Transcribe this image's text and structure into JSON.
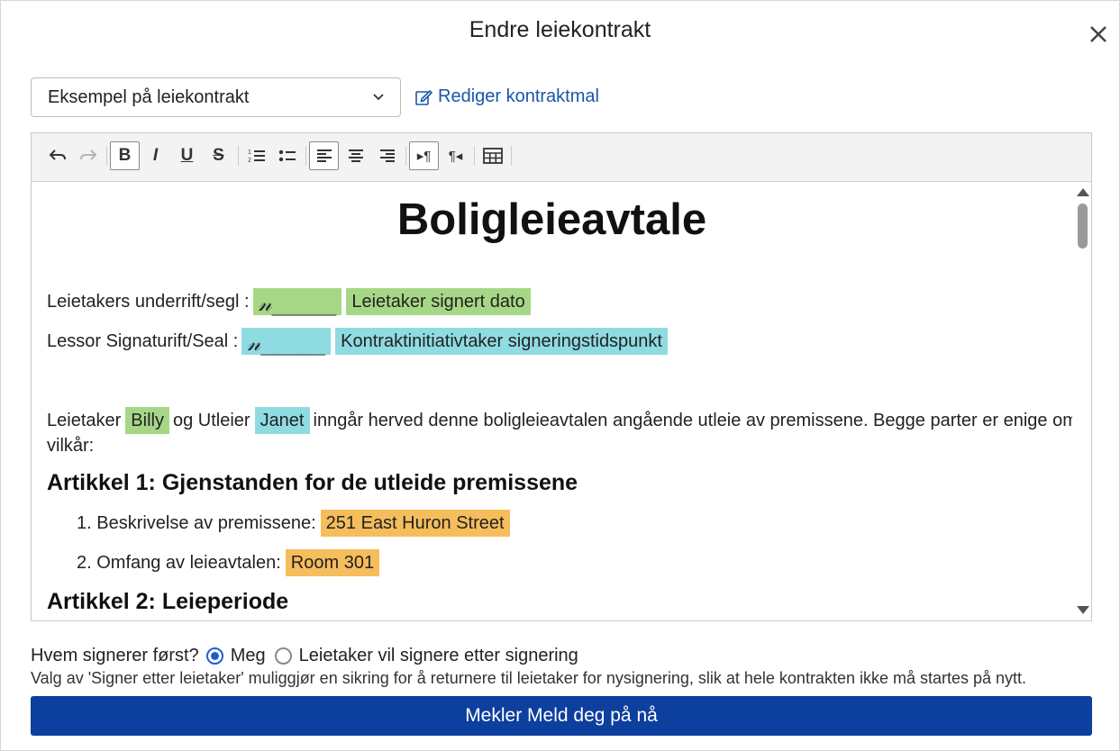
{
  "dialog": {
    "title": "Endre leiekontrakt",
    "close_icon": "close-icon"
  },
  "template_select": {
    "value": "Eksempel på leiekontrakt"
  },
  "edit_template_link": {
    "label": "Rediger kontraktmal",
    "icon": "edit-icon"
  },
  "toolbar": {
    "buttons": [
      {
        "name": "undo",
        "icon": "undo-icon",
        "glyph": "↶"
      },
      {
        "name": "redo",
        "icon": "redo-icon",
        "glyph": "↷",
        "disabled": true
      },
      {
        "name": "bold",
        "icon": "bold-icon",
        "glyph": "B",
        "active": true
      },
      {
        "name": "italic",
        "icon": "italic-icon",
        "glyph": "I"
      },
      {
        "name": "underline",
        "icon": "underline-icon",
        "glyph": "U"
      },
      {
        "name": "strikethrough",
        "icon": "strikethrough-icon",
        "glyph": "S"
      },
      {
        "name": "ordered-list",
        "icon": "ordered-list-icon",
        "glyph": "≡"
      },
      {
        "name": "bullet-list",
        "icon": "bullet-list-icon",
        "glyph": "•"
      },
      {
        "name": "align-left",
        "icon": "align-left-icon",
        "glyph": "≡",
        "active": true
      },
      {
        "name": "align-center",
        "icon": "align-center-icon",
        "glyph": "≡"
      },
      {
        "name": "align-right",
        "icon": "align-right-icon",
        "glyph": "≡"
      },
      {
        "name": "ltr",
        "icon": "ltr-icon",
        "glyph": "▸¶",
        "active": true
      },
      {
        "name": "rtl",
        "icon": "rtl-icon",
        "glyph": "¶◂"
      },
      {
        "name": "table",
        "icon": "table-icon",
        "glyph": "⊞"
      }
    ]
  },
  "document": {
    "title": "Boligleieavtale",
    "tenant_signature_label": "Leietakers underrift/segl :",
    "tenant_signature_field": "𝓃______",
    "tenant_signed_date": "Leietaker signert dato",
    "lessor_signature_label": "Lessor Signaturift/Seal :",
    "lessor_signature_field": "𝓃______",
    "initiator_signing_time": "Kontraktinitiativtaker signeringstidspunkt",
    "intro_prefix": "Leietaker",
    "tenant_name": "Billy",
    "intro_middle": "og Utleier",
    "landlord_name": "Janet",
    "intro_suffix": "inngår herved denne boligleieavtalen angående utleie av premissene. Begge parter er enige om følgende",
    "intro_suffix_line2": "vilkår:",
    "article1_heading": "Artikkel 1: Gjenstanden for de utleide premissene",
    "item1_label": "1. Beskrivelse av premissene:",
    "item1_value": "251 East Huron Street",
    "item2_label": "2. Omfang av leieavtalen:",
    "item2_value": "Room 301",
    "article2_heading": "Artikkel 2: Leieperiode"
  },
  "signer": {
    "question": "Hvem signerer først?",
    "option_me": "Meg",
    "option_tenant": "Leietaker vil signere etter signering",
    "selected": "Meg",
    "hint": "Valg av 'Signer etter leietaker' muliggjør en sikring for å returnere til leietaker for nysignering, slik at hele kontrakten ikke må startes på nytt."
  },
  "primary_button": {
    "label": "Mekler Meld deg på nå"
  },
  "colors": {
    "accent": "#0d3f9e",
    "link": "#1a56a8",
    "tenant_highlight": "#a6d787",
    "landlord_highlight": "#8fdbe2",
    "property_highlight": "#f6bd5c"
  }
}
